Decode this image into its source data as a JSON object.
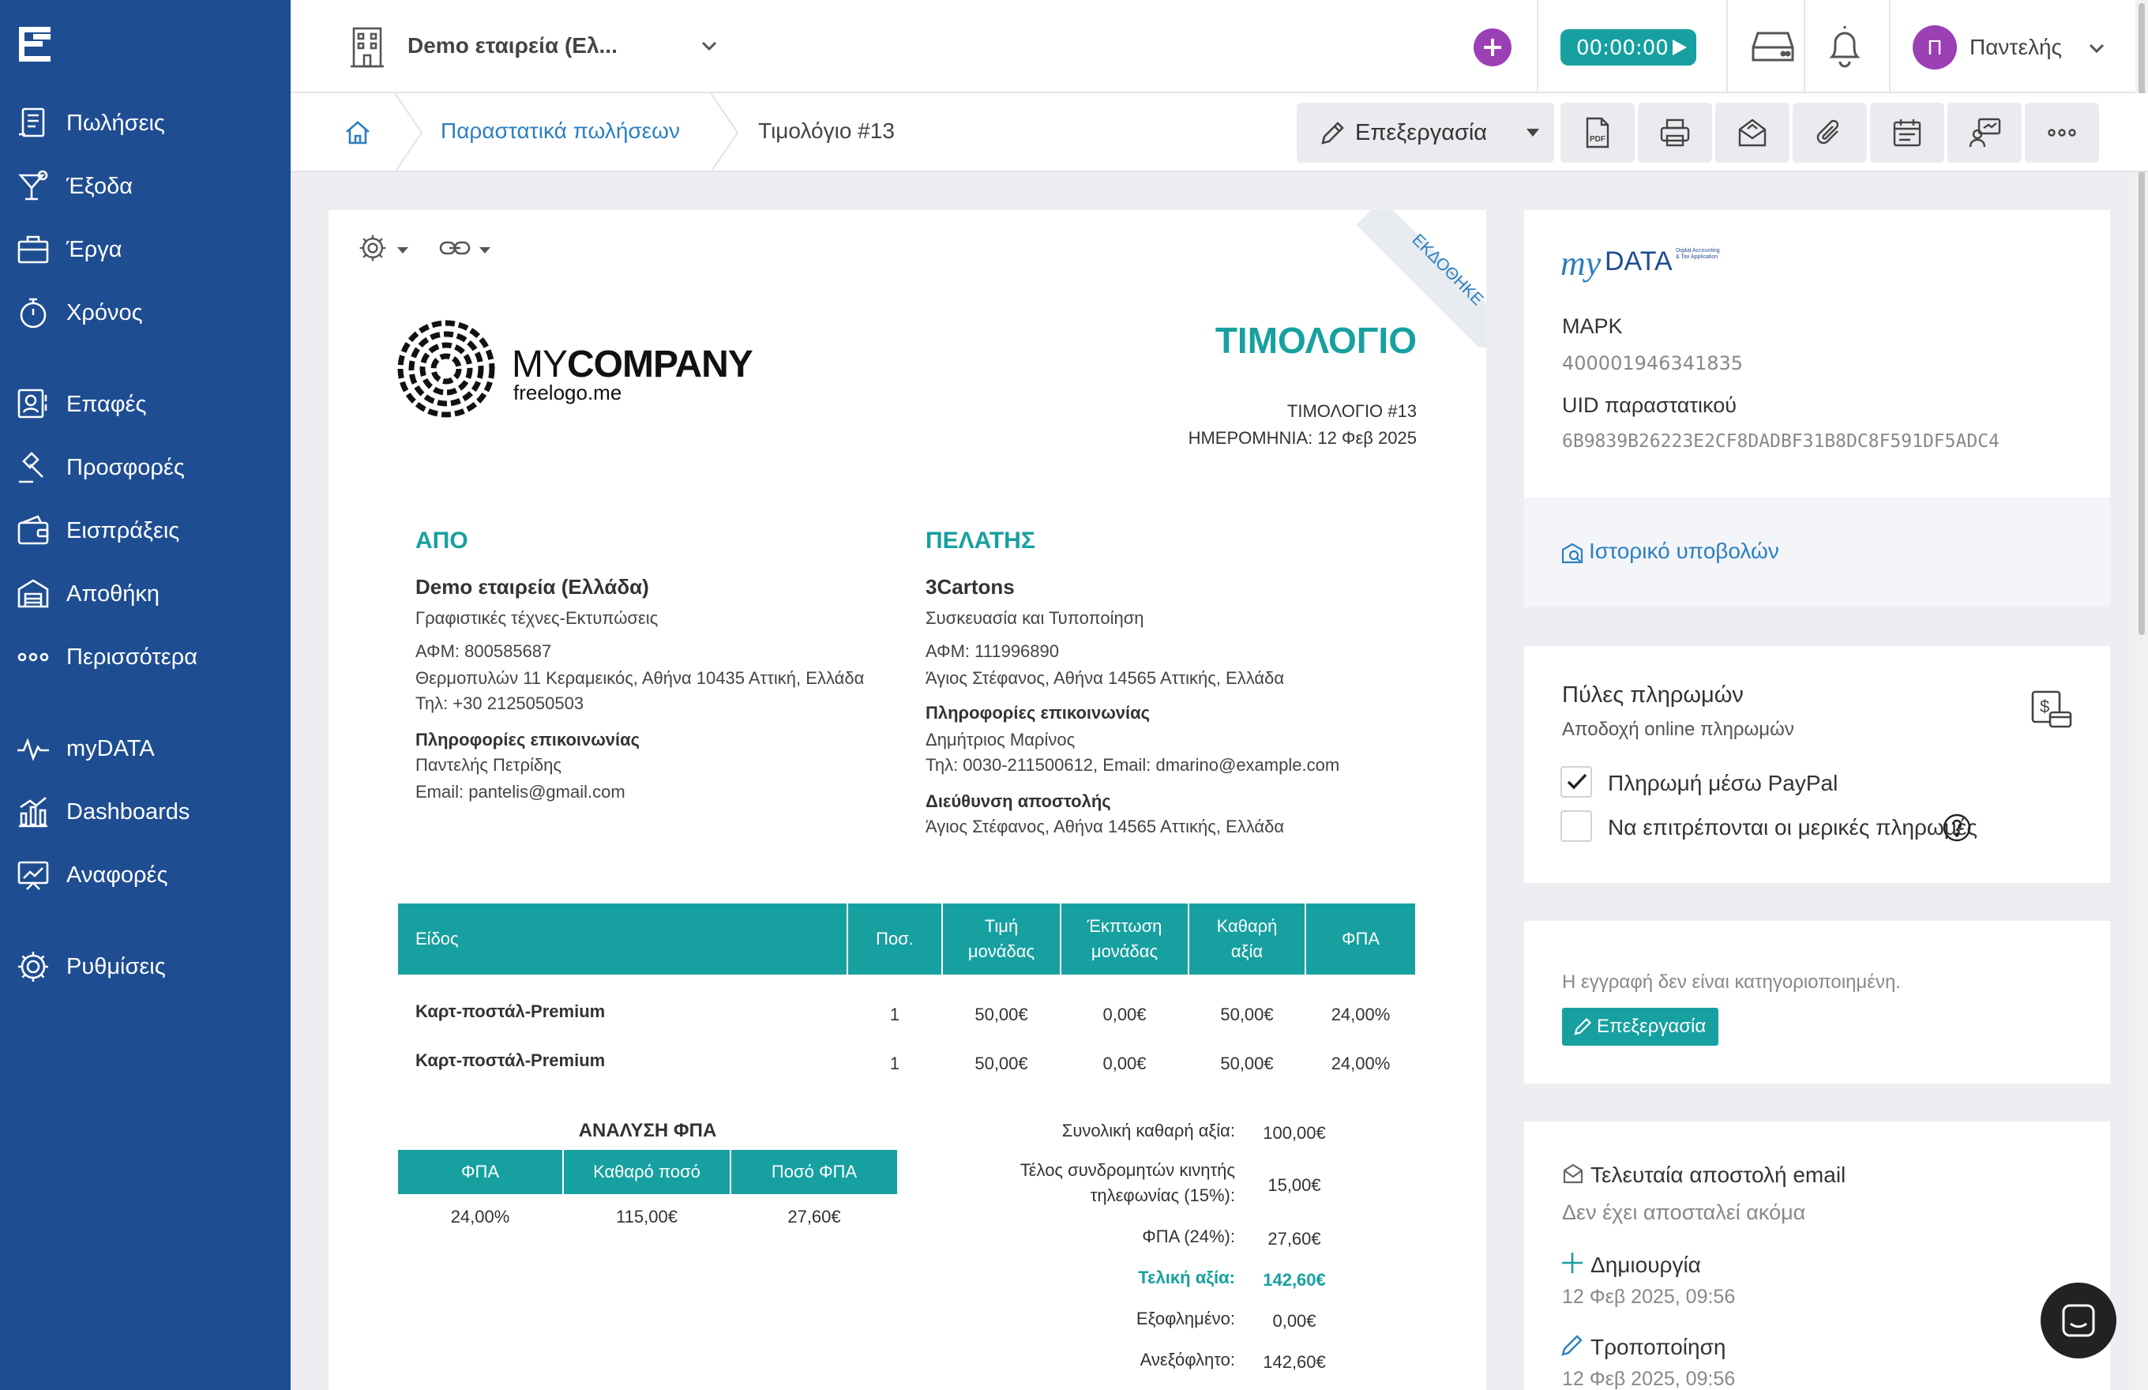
{
  "header": {
    "company": "Demo εταιρεία (Ελ...",
    "timer": "00:00:00",
    "user": "Παντελής",
    "user_initial": "Π"
  },
  "sidebar": {
    "items": [
      {
        "label": "Πωλήσεις",
        "icon": "invoice-icon"
      },
      {
        "label": "Έξοδα",
        "icon": "cocktail-icon"
      },
      {
        "label": "Έργα",
        "icon": "briefcase-icon"
      },
      {
        "label": "Χρόνος",
        "icon": "stopwatch-icon"
      },
      {
        "label": "Επαφές",
        "icon": "contact-icon"
      },
      {
        "label": "Προσφορές",
        "icon": "gavel-icon"
      },
      {
        "label": "Εισπράξεις",
        "icon": "wallet-icon"
      },
      {
        "label": "Αποθήκη",
        "icon": "warehouse-icon"
      },
      {
        "label": "Περισσότερα",
        "icon": "dots-icon"
      },
      {
        "label": "myDATA",
        "icon": "pulse-icon"
      },
      {
        "label": "Dashboards",
        "icon": "bar-chart-icon"
      },
      {
        "label": "Αναφορές",
        "icon": "report-icon"
      },
      {
        "label": "Ρυθμίσεις",
        "icon": "gear-icon"
      }
    ]
  },
  "breadcrumb": {
    "link": "Παραστατικά πωλήσεων",
    "current": "Τιμολόγιο #13"
  },
  "toolbar": {
    "edit_label": "Επεξεργασία"
  },
  "invoice": {
    "ribbon": "ΕΚΔΟΘΗΚΕ",
    "logo_text_a": "MY",
    "logo_text_b": "COMPANY",
    "logo_sub": "freelogo.me",
    "title": "ΤΙΜΟΛΟΓΙΟ",
    "number": "ΤΙΜΟΛΟΓΙΟ #13",
    "date": "ΗΜΕΡΟΜΗΝΙΑ: 12 Φεβ 2025",
    "from": {
      "heading": "ΑΠΟ",
      "name": "Demo εταιρεία (Ελλάδα)",
      "activity": "Γραφιστικές τέχνες-Εκτυπώσεις",
      "vat": "ΑΦΜ: 800585687",
      "address": "Θερμοπυλών 11 Κεραμεικός, Αθήνα 10435 Αττική, Ελλάδα",
      "phone": "Τηλ: +30 2125050503",
      "contact_heading": "Πληροφορίες επικοινωνίας",
      "contact_name": "Παντελής Πετρίδης",
      "contact_email": "Email: pantelis@gmail.com"
    },
    "client": {
      "heading": "ΠΕΛΑΤΗΣ",
      "name": "3Cartons",
      "activity": "Συσκευασία και Τυποποίηση",
      "vat": "ΑΦΜ: 111996890",
      "address": "Άγιος Στέφανος, Αθήνα 14565 Αττικής, Ελλάδα",
      "contact_heading": "Πληροφορίες επικοινωνίας",
      "contact_name": "Δημήτριος Μαρίνος",
      "contact_details": "Τηλ: 0030-211500612, Email: dmarino@example.com",
      "shipping_heading": "Διεύθυνση αποστολής",
      "shipping_address": "Άγιος Στέφανος, Αθήνα 14565 Αττικής, Ελλάδα"
    },
    "items_table": {
      "headers": [
        "Είδος",
        "Ποσ.",
        "Τιμή μονάδας",
        "Έκπτωση μονάδας",
        "Καθαρή αξία",
        "ΦΠΑ"
      ],
      "header_lines": {
        "price": [
          "Τιμή",
          "μονάδας"
        ],
        "discount": [
          "Έκπτωση",
          "μονάδας"
        ],
        "net": [
          "Καθαρή",
          "αξία"
        ]
      },
      "rows": [
        [
          "Καρτ-ποστάλ-Premium",
          "1",
          "50,00€",
          "0,00€",
          "50,00€",
          "24,00%"
        ],
        [
          "Καρτ-ποστάλ-Premium",
          "1",
          "50,00€",
          "0,00€",
          "50,00€",
          "24,00%"
        ]
      ]
    },
    "vat_analysis": {
      "title": "ΑΝΑΛΥΣΗ ΦΠΑ",
      "headers": [
        "ΦΠΑ",
        "Καθαρό ποσό",
        "Ποσό ΦΠΑ"
      ],
      "row": [
        "24,00%",
        "115,00€",
        "27,60€"
      ]
    },
    "totals": {
      "net_label": "Συνολική καθαρή αξία:",
      "net_value": "100,00€",
      "fee_label_1": "Τέλος συνδρομητών κινητής",
      "fee_label_2": "τηλεφωνίας (15%):",
      "fee_value": "15,00€",
      "vat_label": "ΦΠΑ (24%):",
      "vat_value": "27,60€",
      "total_label": "Τελική αξία:",
      "total_value": "142,60€",
      "paid_label": "Εξοφλημένο:",
      "paid_value": "0,00€",
      "due_label": "Ανεξόφλητο:",
      "due_value": "142,60€"
    }
  },
  "mydata": {
    "logo_my": "my",
    "logo_data": "DATA",
    "logo_tag": "Digital Accounting & Tax Application",
    "mark_label": "ΜΑΡΚ",
    "mark_value": "400001946341835",
    "uid_label": "UID παραστατικού",
    "uid_value": "6B9839B26223E2CF8DADBF31B8DC8F591DF5ADC4",
    "history_link": "Ιστορικό υποβολών"
  },
  "payments": {
    "title": "Πύλες πληρωμών",
    "subtitle": "Αποδοχή online πληρωμών",
    "paypal_label": "Πληρωμή μέσω PayPal",
    "paypal_checked": true,
    "partial_label": "Να επιτρέπονται οι μερικές πληρωμές",
    "partial_checked": false
  },
  "category": {
    "note": "Η εγγραφή δεν είναι κατηγοριοποιημένη.",
    "edit_label": "Επεξεργασία"
  },
  "activity": {
    "email_title": "Τελευταία αποστολή email",
    "email_status": "Δεν έχει αποσταλεί ακόμα",
    "created_label": "Δημιουργία",
    "created_date": "12 Φεβ 2025, 09:56",
    "modified_label": "Τροποποίηση",
    "modified_date": "12 Φεβ 2025, 09:56"
  },
  "colors": {
    "sidebar": "#1e4d92",
    "accent": "#17a0a0",
    "add_button": "#9b3fb5",
    "link": "#2c7fc0"
  }
}
